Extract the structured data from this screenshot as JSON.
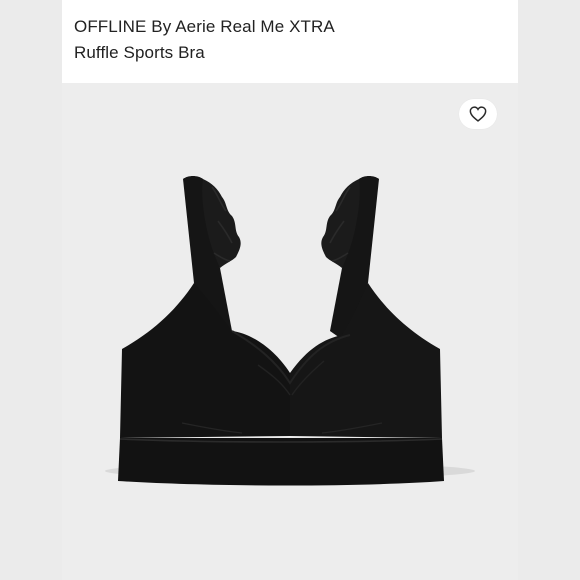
{
  "listing": {
    "title": "OFFLINE By Aerie Real Me XTRA\nRuffle Sports Bra"
  },
  "favorite": {
    "icon": "heart-outline-icon",
    "selected": false
  },
  "product_image": {
    "subject": "black-sports-bra-with-ruffle-straps",
    "colors": {
      "background": "#ededed",
      "garment": "#141414"
    }
  }
}
